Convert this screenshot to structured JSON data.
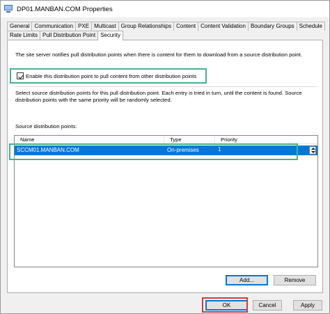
{
  "window": {
    "title": "DP01.MANBAN.COM Properties",
    "icon": "computer-icon"
  },
  "tabs": {
    "row1": [
      "General",
      "Communication",
      "PXE",
      "Multicast",
      "Group Relationships",
      "Content",
      "Content Validation",
      "Boundary Groups",
      "Schedule"
    ],
    "row2": [
      "Rate Limits",
      "Pull Distribution Point",
      "Security"
    ],
    "active": "Pull Distribution Point"
  },
  "panel": {
    "description": "The site server notifies pull distribution points when there is content for them to download from a source distribution point.",
    "enable_checkbox": {
      "label": "Enable this distribution point to pull content from other distribution points",
      "checked": true
    },
    "source_description": "Select source distribution points for this pull distribution point. Each entry is tried in turn, until the content is found. Source distribution points with the same priority will be randomly selected.",
    "list_label": "Source distribution points:",
    "columns": [
      "Name",
      "Type",
      "Priority"
    ],
    "rows": [
      {
        "name": "SCCM01.MANBAN.COM",
        "type": "On-premises",
        "priority": "1",
        "selected": true
      }
    ],
    "add_label": "Add...",
    "remove_label": "Remove"
  },
  "buttons": {
    "ok": "OK",
    "cancel": "Cancel",
    "apply": "Apply"
  },
  "colors": {
    "selection": "#0078d7",
    "highlight_green": "#3fb48c",
    "highlight_red": "#d43a3a"
  }
}
